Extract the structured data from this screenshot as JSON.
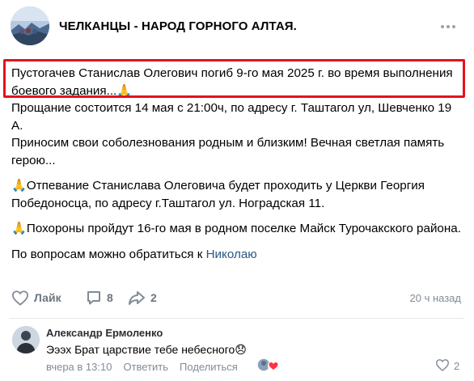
{
  "header": {
    "group_name": "ЧЕЛКАНЦЫ - НАРОД ГОРНОГО АЛТАЯ.",
    "avatar_icon": "group-avatar-icon",
    "more_icon": "more-dots-icon"
  },
  "post": {
    "line1": "Пустогачев Станислав Олегович погиб 9-го мая 2025 г. во время выполнения боевого задания...🙏",
    "line2": "Прощание состоится 14 мая с 21:00ч, по адресу г. Таштагол ул, Шевченко 19 А.",
    "line3": "Приносим свои соболезнования родным и близким! Вечная светлая память герою...",
    "line4": "🙏Отпевание Станислава Олеговича будет проходить у Церкви Георгия Победоносца, по адресу г.Таштагол ул. Ноградская 11.",
    "line5": "🙏Похороны пройдут 16-го мая в родном поселке Майск Турочакского района.",
    "line6_prefix": "По вопросам можно обратиться к ",
    "line6_link": "Николаю"
  },
  "actions": {
    "like_label": "Лайк",
    "comments_count": "8",
    "share_count": "2",
    "time": "20 ч назад",
    "icons": [
      "heart-icon",
      "comment-icon",
      "share-icon"
    ]
  },
  "comment": {
    "author": "Александр Ермоленко",
    "text": "Эээх Брат царствие тебе небесного😞",
    "date": "вчера в 13:10",
    "reply_label": "Ответить",
    "share_label": "Поделиться",
    "likes_count": "2"
  },
  "colors": {
    "highlight": "#e2131c",
    "link": "#2a5885",
    "muted": "#818c99"
  }
}
